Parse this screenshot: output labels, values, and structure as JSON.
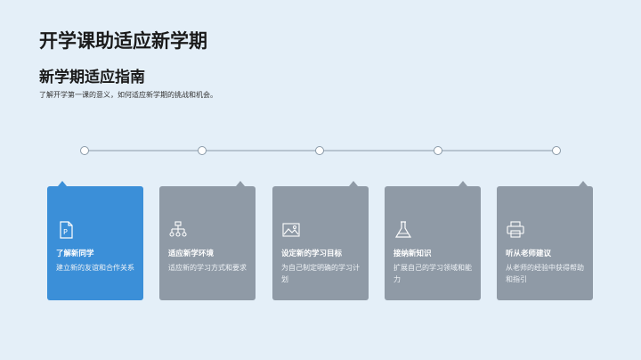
{
  "header": {
    "title": "开学课助适应新学期",
    "subtitle": "新学期适应指南",
    "description": "了解开学第一课的意义，如何适应新学期的挑战和机会。"
  },
  "colors": {
    "background": "#e4eff8",
    "card_active": "#3b8fd8",
    "card_inactive": "#8f9aa6",
    "timeline": "#8a9aa8"
  },
  "cards": [
    {
      "title": "了解新同学",
      "desc": "建立新的友谊和合作关系",
      "icon": "ppt-file-icon",
      "active": true
    },
    {
      "title": "适应新学环境",
      "desc": "适应新的学习方式和要求",
      "icon": "org-chart-icon",
      "active": false
    },
    {
      "title": "设定新的学习目标",
      "desc": "为自己制定明确的学习计划",
      "icon": "image-icon",
      "active": false
    },
    {
      "title": "接纳新知识",
      "desc": "扩展自己的学习领域和能力",
      "icon": "flask-icon",
      "active": false
    },
    {
      "title": "听从老师建议",
      "desc": "从老师的经验中获得帮助和指引",
      "icon": "printer-icon",
      "active": false
    }
  ]
}
